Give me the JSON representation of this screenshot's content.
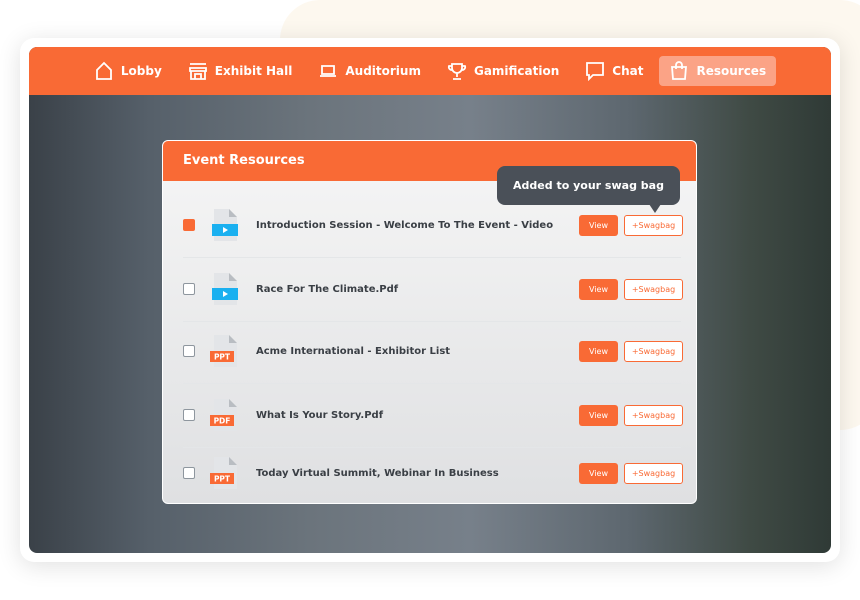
{
  "nav": [
    {
      "label": "Lobby",
      "icon": "home-icon"
    },
    {
      "label": "Exhibit Hall",
      "icon": "store-icon"
    },
    {
      "label": "Auditorium",
      "icon": "laptop-icon"
    },
    {
      "label": "Gamification",
      "icon": "trophy-icon"
    },
    {
      "label": "Chat",
      "icon": "chat-icon"
    },
    {
      "label": "Resources",
      "icon": "bag-icon",
      "active": true
    }
  ],
  "panel": {
    "title": "Event Resources"
  },
  "tooltip": "Added to  your swag bag",
  "rows": [
    {
      "name": "Introduction Session - Welcome To The Event - Video",
      "type": "video",
      "checked": true,
      "view": "View",
      "swag": "+Swagbag"
    },
    {
      "name": "Race For The Climate.Pdf",
      "type": "video",
      "checked": false,
      "view": "View",
      "swag": "+Swagbag"
    },
    {
      "name": "Acme International - Exhibitor List",
      "type": "PPT",
      "checked": false,
      "view": "View",
      "swag": "+Swagbag"
    },
    {
      "name": "What Is Your Story.Pdf",
      "type": "PDF",
      "checked": false,
      "view": "View",
      "swag": "+Swagbag"
    },
    {
      "name": "Today Virtual Summit, Webinar  In Business",
      "type": "PPT",
      "checked": false,
      "view": "View",
      "swag": "+Swagbag"
    }
  ],
  "colors": {
    "accent": "#f96a35",
    "video": "#1ab0f0",
    "tooltip": "#4a5058"
  }
}
